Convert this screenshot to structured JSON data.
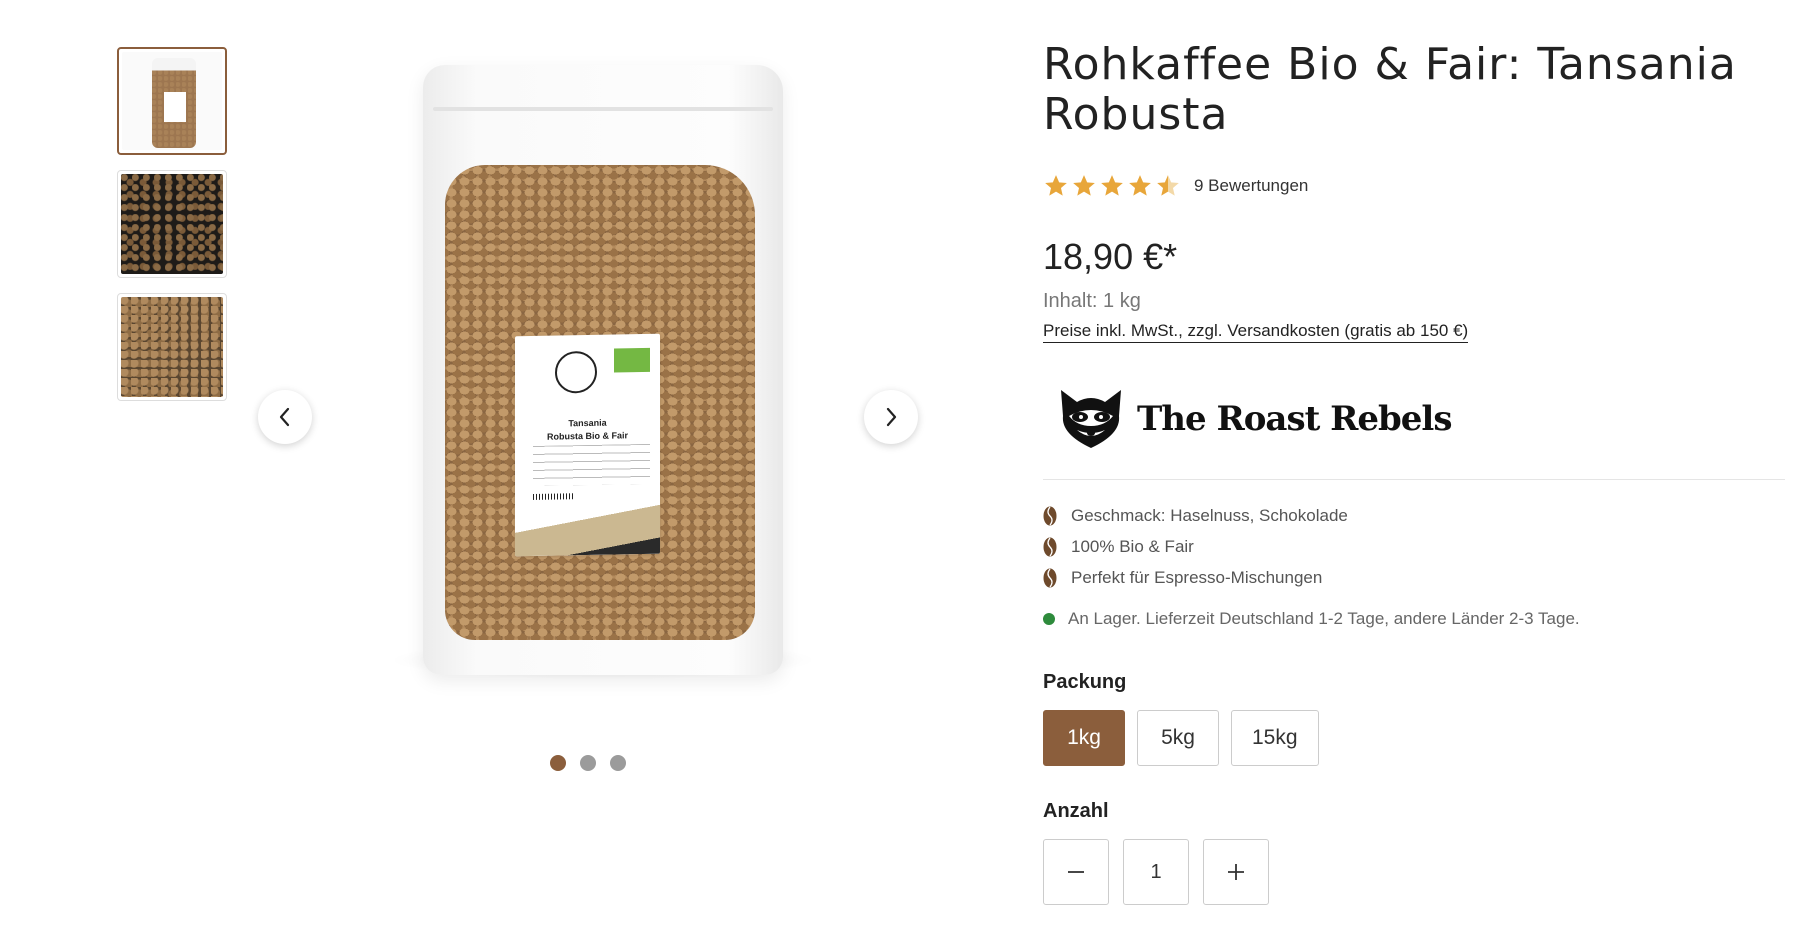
{
  "gallery": {
    "thumbnails": [
      {
        "name": "thumbnail-bag",
        "active": true
      },
      {
        "name": "thumbnail-beans-dark",
        "active": false
      },
      {
        "name": "thumbnail-beans-full",
        "active": false
      }
    ],
    "bag_label": {
      "line1": "Tansania",
      "line2": "Robusta Bio & Fair"
    },
    "dots": 3,
    "active_dot": 1,
    "accent_color": "#8b5e3c"
  },
  "product": {
    "title": "Rohkaffee Bio & Fair: Tansania Robusta",
    "rating": {
      "stars": 4.5,
      "max": 5,
      "reviews_text": "9 Bewertungen",
      "star_color": "#e8a63a"
    },
    "price": "18,90 €*",
    "content": "Inhalt: 1 kg",
    "price_note": "Preise inkl. MwSt., zzgl. Versandkosten (gratis ab 150 €)",
    "brand": {
      "logo_icon": "raccoon-icon",
      "logo_text": "The Roast Rebels"
    },
    "features": [
      "Geschmack: Haselnuss, Schokolade",
      "100% Bio & Fair",
      "Perfekt für Espresso-Mischungen"
    ],
    "stock": {
      "text": "An Lager. Lieferzeit Deutschland 1-2 Tage, andere Länder 2-3 Tage.",
      "color": "#2e8b3c"
    },
    "packaging": {
      "label": "Packung",
      "options": [
        "1kg",
        "5kg",
        "15kg"
      ],
      "selected": "1kg"
    },
    "quantity": {
      "label": "Anzahl",
      "value": "1",
      "minus_icon": "minus-icon",
      "plus_icon": "plus-icon"
    }
  }
}
